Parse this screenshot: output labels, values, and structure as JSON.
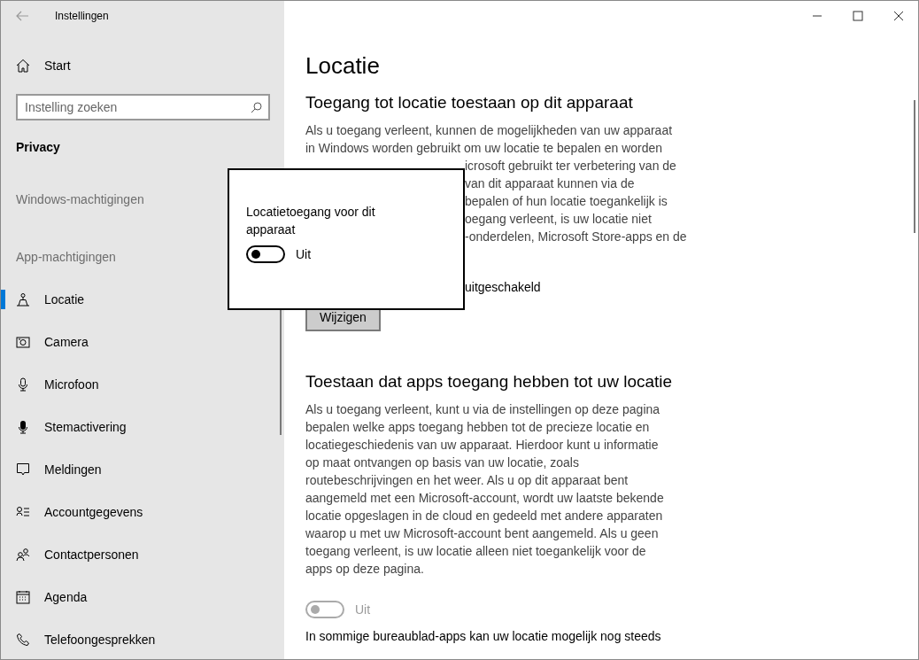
{
  "window": {
    "title": "Instellingen"
  },
  "sidebar": {
    "home": "Start",
    "search": {
      "placeholder": "Instelling zoeken"
    },
    "section": "Privacy",
    "groups": [
      {
        "label": "Windows-machtigingen"
      },
      {
        "label": "App-machtigingen"
      }
    ],
    "items": [
      {
        "label": "Locatie",
        "selected": true
      },
      {
        "label": "Camera",
        "selected": false
      },
      {
        "label": "Microfoon",
        "selected": false
      },
      {
        "label": "Stemactivering",
        "selected": false
      },
      {
        "label": "Meldingen",
        "selected": false
      },
      {
        "label": "Accountgegevens",
        "selected": false
      },
      {
        "label": "Contactpersonen",
        "selected": false
      },
      {
        "label": "Agenda",
        "selected": false
      },
      {
        "label": "Telefoongesprekken",
        "selected": false
      }
    ]
  },
  "page": {
    "title": "Locatie",
    "section_1": {
      "heading": "Toegang tot locatie toestaan op dit apparaat",
      "lines": [
        {
          "text": "Als u toegang verleent, kunnen de mogelijkheden van uw apparaat",
          "covered": false
        },
        {
          "text": "in Windows worden gebruikt om uw locatie te bepalen en worden",
          "covered": false
        },
        {
          "text": "icrosoft gebruikt ter verbetering van de",
          "covered": true
        },
        {
          "text": "van dit apparaat kunnen via de",
          "covered": true
        },
        {
          "text": "bepalen of hun locatie toegankelijk is",
          "covered": true
        },
        {
          "text": "oegang verleent, is uw locatie niet",
          "covered": true
        },
        {
          "text": "-onderdelen, Microsoft Store-apps en de",
          "covered": true
        }
      ],
      "status": "uitgeschakeld",
      "button": "Wijzigen"
    },
    "section_2": {
      "heading": "Toestaan dat apps toegang hebben tot uw locatie",
      "lines": [
        "Als u toegang verleent, kunt u via de instellingen op deze pagina",
        "bepalen welke apps toegang hebben tot de precieze locatie en",
        "locatiegeschiedenis van uw apparaat. Hierdoor kunt u informatie",
        "op maat ontvangen op basis van uw locatie, zoals",
        "routebeschrijvingen en het weer. Als u op dit apparaat bent",
        "aangemeld met een Microsoft-account, wordt uw laatste bekende",
        "locatie opgeslagen in de cloud en gedeeld met andere apparaten",
        "waarop u met uw Microsoft-account bent aangemeld. Als u geen",
        "toegang verleent, is uw locatie alleen niet toegankelijk voor de",
        "apps op deze pagina."
      ],
      "toggle": {
        "on": false,
        "disabled": true,
        "state_text": "Uit"
      },
      "footer": "In sommige bureaublad-apps kan uw locatie mogelijk nog steeds"
    }
  },
  "popup": {
    "label": "Locatietoegang voor dit apparaat",
    "toggle": {
      "on": false,
      "disabled": false,
      "state_text": "Uit"
    }
  }
}
